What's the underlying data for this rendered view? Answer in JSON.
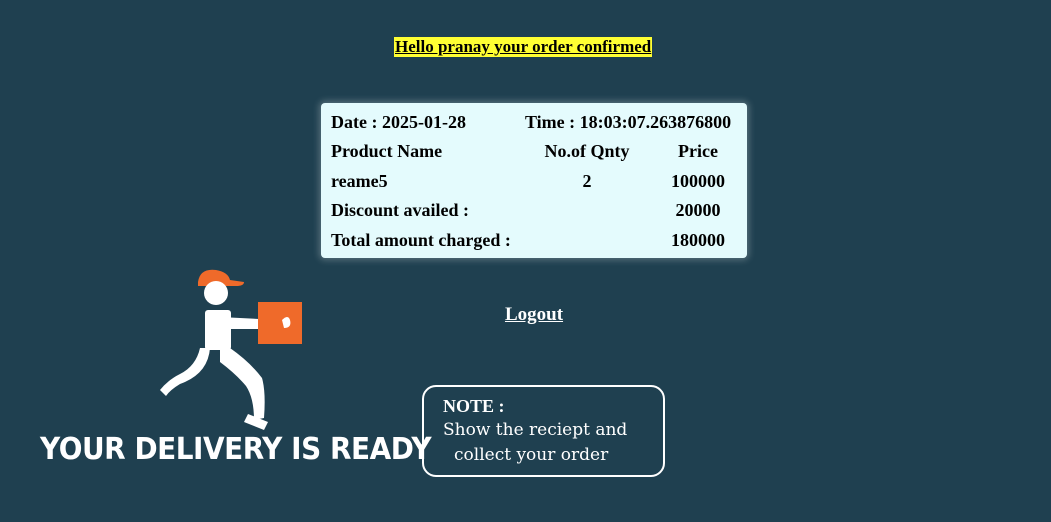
{
  "greeting": "Hello pranay your order confirmed",
  "receipt": {
    "date_label": "Date : 2025-01-28",
    "time_label": "Time : 18:03:07.263876800",
    "headers": {
      "product": "Product Name",
      "qty": "No.of Qnty",
      "price": "Price"
    },
    "item": {
      "name": "reame5",
      "qty": "2",
      "price": "100000"
    },
    "discount": {
      "label": "Discount availed :",
      "value": "20000"
    },
    "total": {
      "label": "Total amount charged :",
      "value": "180000"
    }
  },
  "logout_label": "Logout",
  "note": {
    "title": "NOTE :",
    "line1": "Show the reciept and",
    "line2": "collect your order"
  },
  "delivery_banner": "YOUR DELIVERY IS READY",
  "colors": {
    "background": "#1f4050",
    "highlight": "#ffff33",
    "card": "#e4fbfd",
    "accent_orange": "#ef6a2a"
  },
  "icons": {
    "delivery_person": "delivery-person-icon"
  }
}
